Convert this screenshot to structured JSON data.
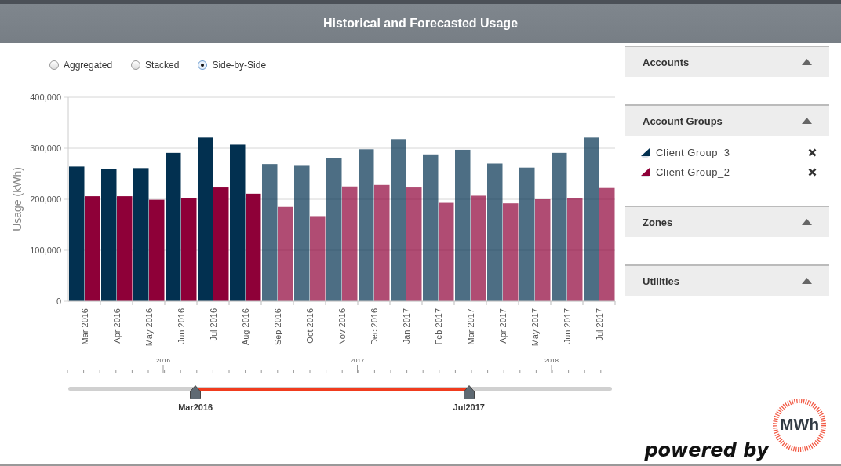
{
  "header": {
    "title": "Historical and Forecasted Usage"
  },
  "view_modes": [
    {
      "label": "Aggregated",
      "selected": false
    },
    {
      "label": "Stacked",
      "selected": false
    },
    {
      "label": "Side-by-Side",
      "selected": true
    }
  ],
  "chart": {
    "bar_groups": [
      {
        "forecast": false
      },
      {
        "forecast": false
      },
      {
        "forecast": false
      },
      {
        "forecast": false
      },
      {
        "forecast": false
      },
      {
        "forecast": false
      },
      {
        "forecast": true
      },
      {
        "forecast": true
      },
      {
        "forecast": true
      },
      {
        "forecast": true
      },
      {
        "forecast": true
      },
      {
        "forecast": true
      },
      {
        "forecast": true
      },
      {
        "forecast": true
      },
      {
        "forecast": true
      },
      {
        "forecast": true
      },
      {
        "forecast": true
      }
    ],
    "chart_data": {
      "type": "bar",
      "grid": true,
      "ylabel": "Usage (kWh)",
      "categories": [
        "Mar 2016",
        "Apr 2016",
        "May 2016",
        "Jun 2016",
        "Jul 2016",
        "Aug 2016",
        "Sep 2016",
        "Oct 2016",
        "Nov 2016",
        "Dec 2016",
        "Jan 2017",
        "Feb 2017",
        "Mar 2017",
        "Apr 2017",
        "May 2017",
        "Jun 2017",
        "Jul 2017"
      ],
      "series": [
        {
          "color": "#023050",
          "values": [
            264000,
            260000,
            261000,
            291000,
            321000,
            307000,
            269000,
            267000,
            280000,
            298000,
            318000,
            288000,
            297000,
            270000,
            262000,
            291000,
            321000
          ]
        },
        {
          "color": "#8e0038",
          "values": [
            206000,
            206000,
            199000,
            203000,
            223000,
            211000,
            185000,
            167000,
            225000,
            228000,
            223000,
            193000,
            207000,
            192000,
            200000,
            203000,
            222000
          ]
        }
      ],
      "ylim": [
        0,
        400000
      ],
      "yticks": [
        {
          "value": 0,
          "label": "0"
        },
        {
          "value": 100000,
          "label": "100,000"
        },
        {
          "value": 200000,
          "label": "200,000"
        },
        {
          "value": 300000,
          "label": "300,000"
        },
        {
          "value": 400000,
          "label": "400,000"
        }
      ]
    }
  },
  "timeline": {
    "years": [
      "2016",
      "2017",
      "2018"
    ],
    "handles": [
      {
        "label": "Mar2016",
        "level": 0.234
      },
      {
        "label": "Jul2017",
        "level": 0.737
      }
    ]
  },
  "panels": [
    {
      "title": "Accounts",
      "expanded": true
    },
    {
      "title": "Account Groups",
      "expanded": true,
      "items": [
        {
          "label": "Client Group_3",
          "color": "#023050"
        },
        {
          "label": "Client Group_2",
          "color": "#8e0038"
        }
      ]
    },
    {
      "title": "Zones",
      "expanded": true
    },
    {
      "title": "Utilities",
      "expanded": true
    }
  ],
  "branding": {
    "powered_by": "powered by",
    "logo_text": "MWh"
  }
}
